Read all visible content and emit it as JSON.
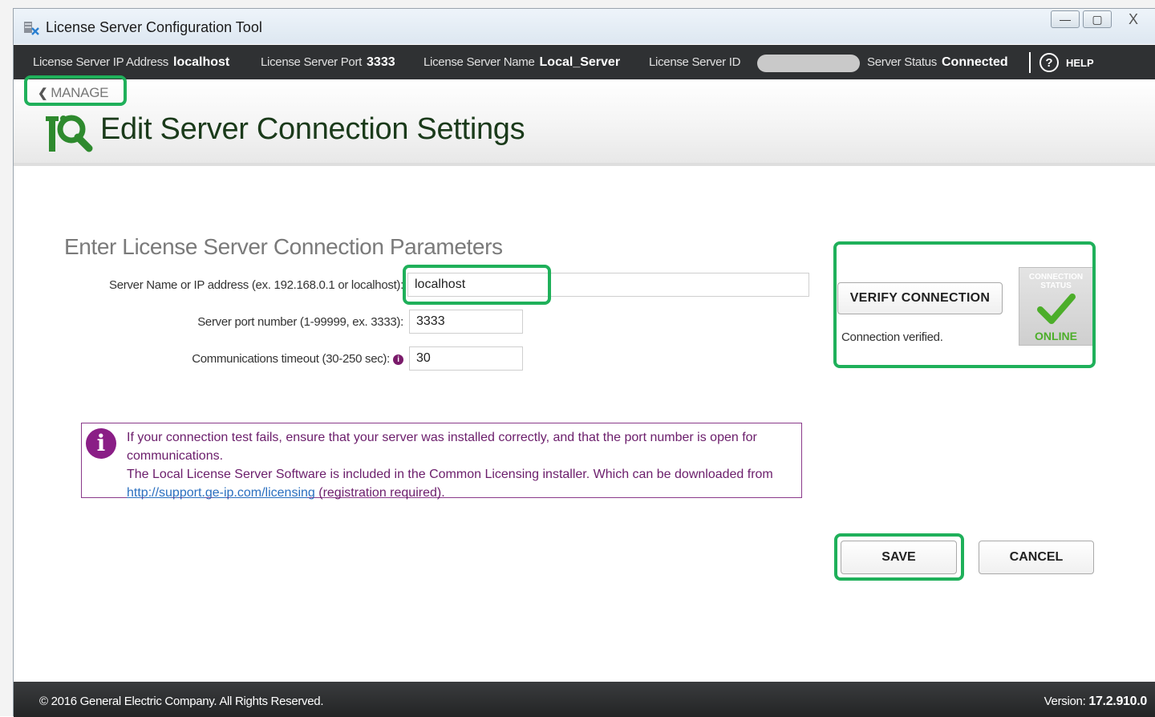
{
  "window": {
    "title": "License Server Configuration Tool",
    "controls": {
      "minimize": "—",
      "maximize": "▢",
      "close": "X"
    }
  },
  "status_bar": {
    "ip_label": "License Server IP Address",
    "ip_value": "localhost",
    "port_label": "License Server Port",
    "port_value": "3333",
    "name_label": "License Server Name",
    "name_value": "Local_Server",
    "id_label": "License Server ID",
    "status_label": "Server Status",
    "status_value": "Connected",
    "help_glyph": "?",
    "help_label": "HELP"
  },
  "header": {
    "back_label": "MANAGE",
    "page_title": "Edit Server Connection Settings"
  },
  "form": {
    "section_title": "Enter License Server Connection Parameters",
    "server_label": "Server Name or IP address (ex. 192.168.0.1 or localhost):",
    "server_value": "localhost",
    "port_label": "Server port number (1-99999, ex. 3333):",
    "port_value": "3333",
    "timeout_label": "Communications timeout (30-250 sec):",
    "timeout_value": "30"
  },
  "note": {
    "line1": "If your connection test fails, ensure that your server was installed correctly, and that the port number is open for communications.",
    "line2_prefix": "The Local License Server Software is included in the Common Licensing installer. Which can be downloaded from ",
    "link_text": "http://support.ge-ip.com/licensing",
    "line2_suffix": " (registration required)."
  },
  "verify": {
    "button_label": "VERIFY CONNECTION",
    "message": "Connection verified.",
    "tile_heading_1": "CONNECTION",
    "tile_heading_2": "STATUS",
    "tile_state": "ONLINE"
  },
  "actions": {
    "save_label": "SAVE",
    "cancel_label": "CANCEL"
  },
  "footer": {
    "copyright": "© 2016 General Electric Company.  All Rights Reserved.",
    "version_label": "Version:",
    "version_value": "17.2.910.0"
  },
  "colors": {
    "highlight": "#1fb05a",
    "status_bar_bg": "#2f3133",
    "note_border": "#8a3a8a",
    "online_green": "#4cae2a"
  }
}
